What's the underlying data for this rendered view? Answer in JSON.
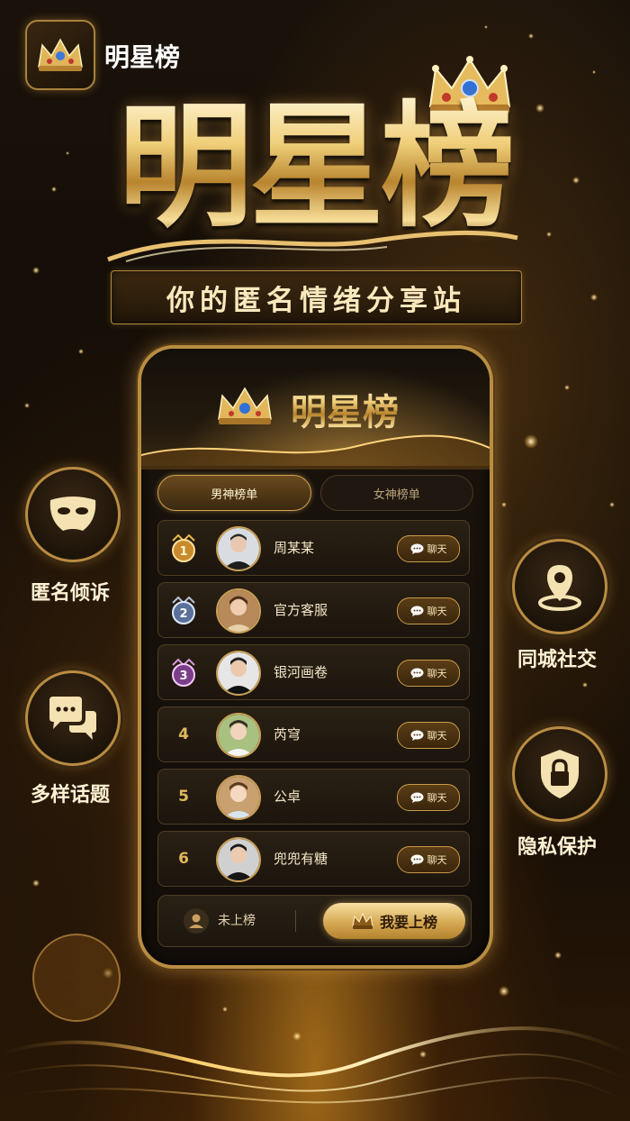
{
  "app": {
    "name": "明星榜",
    "icon": "crown-icon"
  },
  "hero": {
    "title": "明星榜",
    "subtitle": "你的匿名情绪分享站"
  },
  "phone": {
    "title": "明星榜",
    "tabs": [
      {
        "label": "男神榜单",
        "active": true
      },
      {
        "label": "女神榜单",
        "active": false
      }
    ],
    "rankings": [
      {
        "rank": "1",
        "name": "周某某",
        "chat_label": "聊天",
        "badge": "gold"
      },
      {
        "rank": "2",
        "name": "官方客服",
        "chat_label": "聊天",
        "badge": "silver"
      },
      {
        "rank": "3",
        "name": "银河画卷",
        "chat_label": "聊天",
        "badge": "purple"
      },
      {
        "rank": "4",
        "name": "芮穹",
        "chat_label": "聊天",
        "badge": "none"
      },
      {
        "rank": "5",
        "name": "公卓",
        "chat_label": "聊天",
        "badge": "none"
      },
      {
        "rank": "6",
        "name": "兜兜有糖",
        "chat_label": "聊天",
        "badge": "none"
      }
    ],
    "bottom": {
      "status": "未上榜",
      "join_label": "我要上榜"
    }
  },
  "features": [
    {
      "label": "匿名倾诉",
      "icon": "mask-icon"
    },
    {
      "label": "多样话题",
      "icon": "chat-bubbles-icon"
    },
    {
      "label": "同城社交",
      "icon": "location-pin-icon"
    },
    {
      "label": "隐私保护",
      "icon": "lock-shield-icon"
    }
  ],
  "colors": {
    "gold": "#d6a954",
    "background": "#120c06",
    "accent": "#b88d42"
  }
}
